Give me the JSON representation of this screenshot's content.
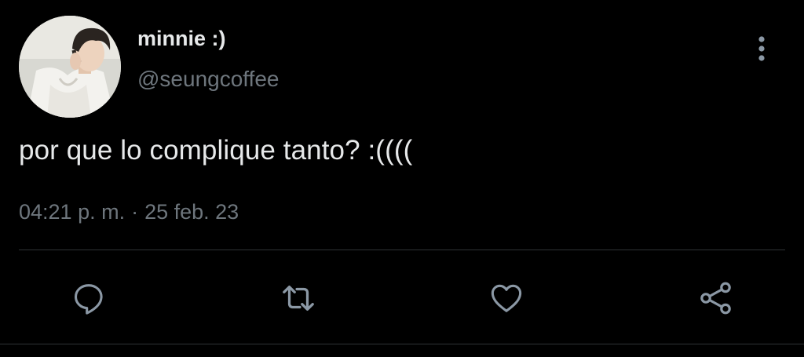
{
  "tweet": {
    "display_name": "minnie :)",
    "handle": "@seungcoffee",
    "text": "por que lo complique tanto? :((((",
    "time": "04:21 p. m.",
    "separator": "·",
    "date": "25 feb. 23"
  },
  "icons": {
    "more": "more-vertical-icon",
    "reply": "reply-icon",
    "retweet": "retweet-icon",
    "like": "heart-icon",
    "share": "share-icon"
  },
  "colors": {
    "background": "#000000",
    "primary_text": "#e7e9ea",
    "secondary_text": "#6e767d",
    "divider": "#2f3336",
    "icon": "#8b98a5"
  }
}
